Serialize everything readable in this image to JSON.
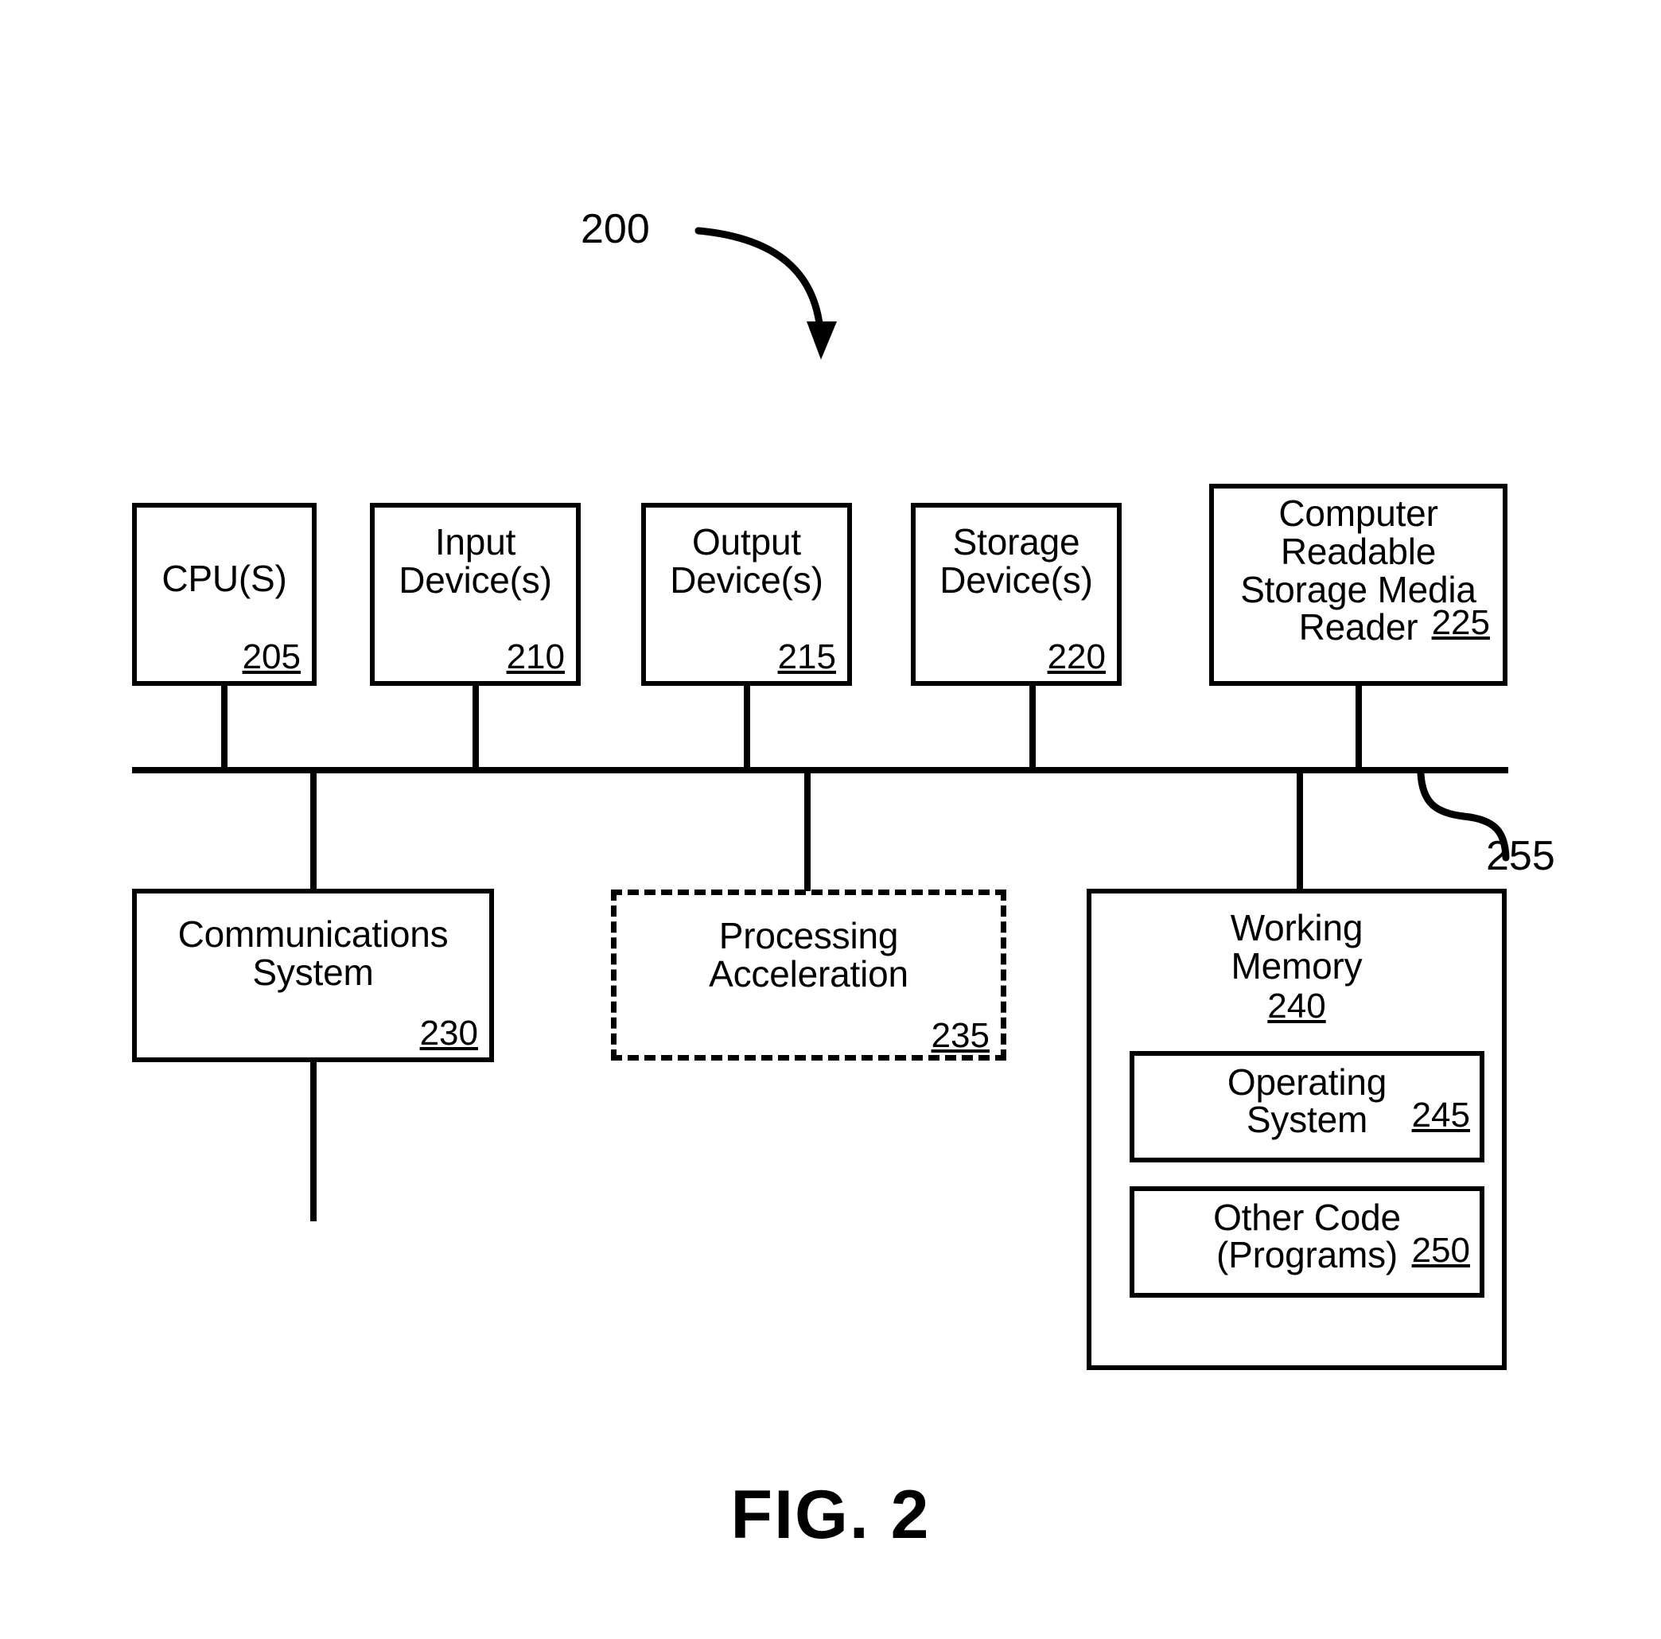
{
  "figure": {
    "caption": "FIG. 2",
    "system_label": "200",
    "bus_label": "255"
  },
  "top_row": [
    {
      "title": "CPU(S)",
      "ref": "205"
    },
    {
      "title": "Input\nDevice(s)",
      "ref": "210"
    },
    {
      "title": "Output\nDevice(s)",
      "ref": "215"
    },
    {
      "title": "Storage\nDevice(s)",
      "ref": "220"
    },
    {
      "title": "Computer\nReadable\nStorage Media\nReader",
      "ref": "225"
    }
  ],
  "bottom_row": {
    "communications": {
      "title": "Communications\nSystem",
      "ref": "230"
    },
    "acceleration": {
      "title": "Processing\nAcceleration",
      "ref": "235"
    },
    "working_memory": {
      "title": "Working\nMemory",
      "ref": "240",
      "children": [
        {
          "title": "Operating\nSystem",
          "ref": "245"
        },
        {
          "title": "Other Code\n(Programs)",
          "ref": "250"
        }
      ]
    }
  }
}
